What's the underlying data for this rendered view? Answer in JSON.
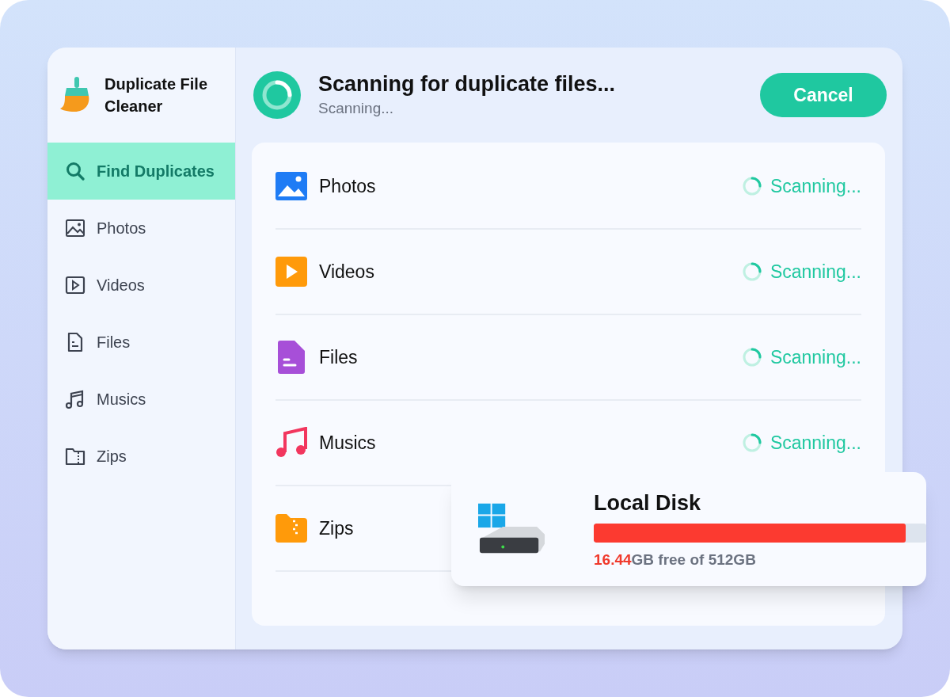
{
  "app": {
    "name": "Duplicate File Cleaner"
  },
  "sidebar": {
    "items": [
      {
        "label": "Find Duplicates",
        "kind": "search",
        "selected": true
      },
      {
        "label": "Photos",
        "kind": "photo",
        "selected": false
      },
      {
        "label": "Videos",
        "kind": "video",
        "selected": false
      },
      {
        "label": "Files",
        "kind": "file",
        "selected": false
      },
      {
        "label": "Musics",
        "kind": "music",
        "selected": false
      },
      {
        "label": "Zips",
        "kind": "zip",
        "selected": false
      }
    ]
  },
  "header": {
    "title": "Scanning for duplicate files...",
    "subtitle": "Scanning...",
    "button": "Cancel"
  },
  "categories": [
    {
      "label": "Photos",
      "kind": "photo",
      "status": "Scanning..."
    },
    {
      "label": "Videos",
      "kind": "video",
      "status": "Scanning..."
    },
    {
      "label": "Files",
      "kind": "file",
      "status": "Scanning..."
    },
    {
      "label": "Musics",
      "kind": "music",
      "status": "Scanning..."
    },
    {
      "label": "Zips",
      "kind": "zip"
    }
  ],
  "disk": {
    "name": "Local Disk",
    "level": 0.938,
    "free": "16.44",
    "free_suffix": "GB free of 512GB"
  }
}
